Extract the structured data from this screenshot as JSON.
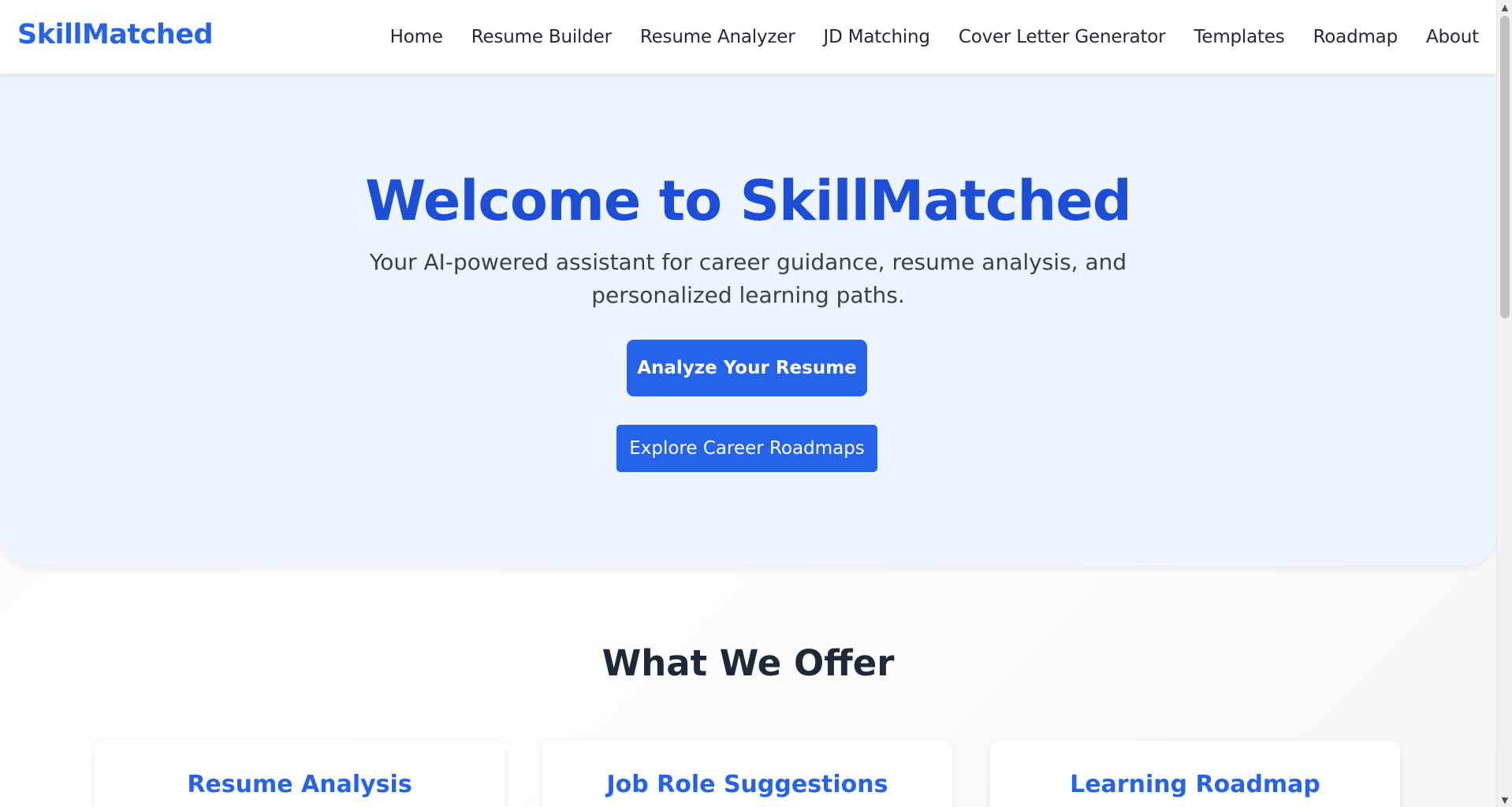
{
  "navbar": {
    "brand": "SkillMatched",
    "links": [
      {
        "label": "Home"
      },
      {
        "label": "Resume Builder"
      },
      {
        "label": "Resume Analyzer"
      },
      {
        "label": "JD Matching"
      },
      {
        "label": "Cover Letter Generator"
      },
      {
        "label": "Templates"
      },
      {
        "label": "Roadmap"
      },
      {
        "label": "About"
      }
    ]
  },
  "hero": {
    "title": "Welcome to SkillMatched",
    "subtitle": "Your AI-powered assistant for career guidance, resume analysis, and personalized learning paths.",
    "primary_button": "Analyze Your Resume",
    "secondary_button": "Explore Career Roadmaps"
  },
  "offer": {
    "title": "What We Offer",
    "cards": [
      {
        "title": "Resume Analysis"
      },
      {
        "title": "Job Role Suggestions"
      },
      {
        "title": "Learning Roadmap"
      }
    ]
  },
  "scrollbar": {
    "up_icon": "triangle-up",
    "down_icon": "triangle-down"
  },
  "colors": {
    "accent": "#2563eb",
    "hero_background": "#eef4fe",
    "heading_dark": "#1f2937"
  }
}
